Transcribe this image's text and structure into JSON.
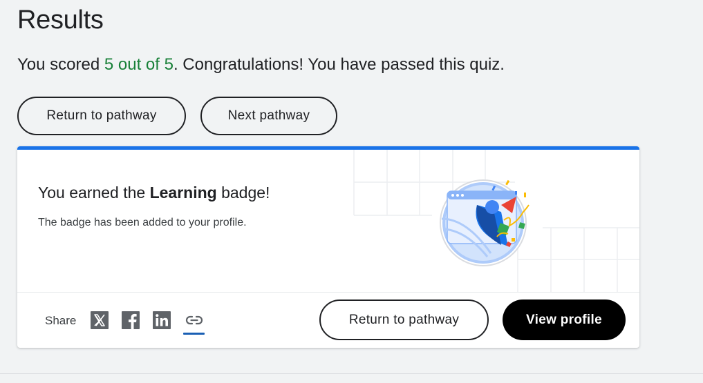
{
  "results": {
    "title": "Results",
    "score_prefix": "You scored ",
    "score_value": "5 out of 5",
    "score_suffix": ". Congratulations! You have passed this quiz.",
    "return_button": "Return to pathway",
    "next_button": "Next pathway"
  },
  "badge_card": {
    "earned_prefix": "You earned the ",
    "badge_name": "Learning",
    "earned_suffix": " badge!",
    "added_text": "The badge has been added to your profile.",
    "share_label": "Share",
    "share_icons": [
      "x-icon",
      "facebook-icon",
      "linkedin-icon",
      "link-icon"
    ],
    "return_button": "Return to pathway",
    "view_profile_button": "View profile"
  },
  "colors": {
    "accent_blue": "#1a73e8",
    "score_green": "#188038",
    "primary_button": "#000000"
  }
}
